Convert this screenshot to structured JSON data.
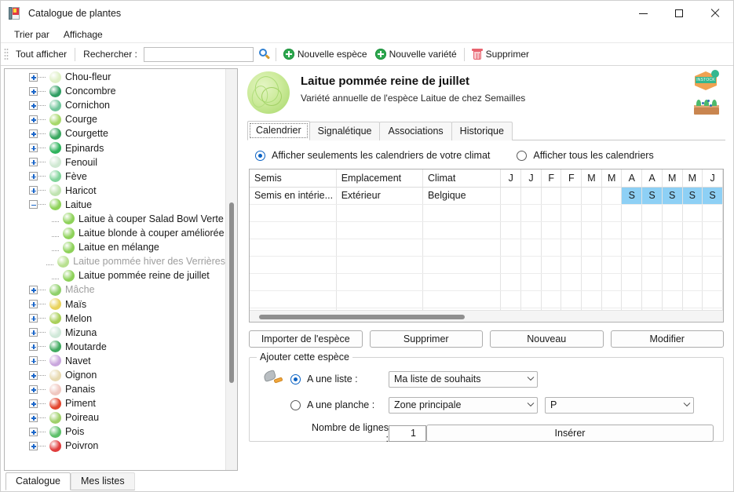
{
  "window": {
    "title": "Catalogue de plantes",
    "icon": "book-icon",
    "minimize": "minimize-icon",
    "maximize": "maximize-icon",
    "close": "close-icon"
  },
  "menubar": {
    "items": [
      "Trier par",
      "Affichage"
    ]
  },
  "toolbar": {
    "show_all": "Tout afficher",
    "search_label": "Rechercher :",
    "search_value": "",
    "search_placeholder": "",
    "search_icon": "search-icon",
    "new_species": "Nouvelle espèce",
    "new_variety": "Nouvelle variété",
    "delete": "Supprimer"
  },
  "tree": {
    "items": [
      {
        "label": "Chou-fleur",
        "level": 0,
        "expander": "plus",
        "dim": false,
        "color": "#dff0c6"
      },
      {
        "label": "Concombre",
        "level": 0,
        "expander": "plus",
        "dim": false,
        "color": "#2e9e62"
      },
      {
        "label": "Cornichon",
        "level": 0,
        "expander": "plus",
        "dim": false,
        "color": "#6fc59a"
      },
      {
        "label": "Courge",
        "level": 0,
        "expander": "plus",
        "dim": false,
        "color": "#a7d86a"
      },
      {
        "label": "Courgette",
        "level": 0,
        "expander": "plus",
        "dim": false,
        "color": "#3aa75f"
      },
      {
        "label": "Epinards",
        "level": 0,
        "expander": "plus",
        "dim": false,
        "color": "#2eb35c"
      },
      {
        "label": "Fenouil",
        "level": 0,
        "expander": "plus",
        "dim": false,
        "color": "#cfe8d2"
      },
      {
        "label": "Fève",
        "level": 0,
        "expander": "plus",
        "dim": false,
        "color": "#7fd39a"
      },
      {
        "label": "Haricot",
        "level": 0,
        "expander": "plus",
        "dim": false,
        "color": "#bfe3b0"
      },
      {
        "label": "Laitue",
        "level": 0,
        "expander": "minus",
        "dim": false,
        "color": "#8ed25a"
      },
      {
        "label": "Laitue à couper Salad Bowl Verte",
        "level": 1,
        "expander": "none",
        "dim": false,
        "color": "#8ed25a"
      },
      {
        "label": "Laitue blonde à couper améliorée",
        "level": 1,
        "expander": "none",
        "dim": false,
        "color": "#8ed25a"
      },
      {
        "label": "Laitue en mélange",
        "level": 1,
        "expander": "none",
        "dim": false,
        "color": "#8ed25a"
      },
      {
        "label": "Laitue pommée hiver des Verrières",
        "level": 1,
        "expander": "none",
        "dim": true,
        "color": "#b8e08f"
      },
      {
        "label": "Laitue pommée reine de juillet",
        "level": 1,
        "expander": "none",
        "dim": false,
        "color": "#8ed25a"
      },
      {
        "label": "Mâche",
        "level": 0,
        "expander": "plus",
        "dim": true,
        "color": "#8fd06a"
      },
      {
        "label": "Maïs",
        "level": 0,
        "expander": "plus",
        "dim": false,
        "color": "#e8d25c"
      },
      {
        "label": "Melon",
        "level": 0,
        "expander": "plus",
        "dim": false,
        "color": "#a9cf58"
      },
      {
        "label": "Mizuna",
        "level": 0,
        "expander": "plus",
        "dim": false,
        "color": "#cfe8d8"
      },
      {
        "label": "Moutarde",
        "level": 0,
        "expander": "plus",
        "dim": false,
        "color": "#3fa95f"
      },
      {
        "label": "Navet",
        "level": 0,
        "expander": "plus",
        "dim": false,
        "color": "#c9a6dd"
      },
      {
        "label": "Oignon",
        "level": 0,
        "expander": "plus",
        "dim": false,
        "color": "#e7d9b0"
      },
      {
        "label": "Panais",
        "level": 0,
        "expander": "plus",
        "dim": false,
        "color": "#f0c7c0"
      },
      {
        "label": "Piment",
        "level": 0,
        "expander": "plus",
        "dim": false,
        "color": "#e2462f"
      },
      {
        "label": "Poireau",
        "level": 0,
        "expander": "plus",
        "dim": false,
        "color": "#9fd06a"
      },
      {
        "label": "Pois",
        "level": 0,
        "expander": "plus",
        "dim": false,
        "color": "#5cc06a"
      },
      {
        "label": "Poivron",
        "level": 0,
        "expander": "plus",
        "dim": false,
        "color": "#e03c3c"
      }
    ],
    "tabs": [
      {
        "label": "Catalogue",
        "active": true
      },
      {
        "label": "Mes listes",
        "active": false
      }
    ]
  },
  "detail": {
    "avatar": "lettuce-icon",
    "title": "Laitue pommée reine de juillet",
    "subtitle": "Variété annuelle de l'espèce Laitue de chez Semailles",
    "badges": [
      {
        "name": "in-stock-badge",
        "label": "INSTOCK"
      },
      {
        "name": "sowing-badge",
        "label": ""
      }
    ],
    "tabs": [
      {
        "label": "Calendrier",
        "active": true
      },
      {
        "label": "Signalétique",
        "active": false
      },
      {
        "label": "Associations",
        "active": false
      },
      {
        "label": "Historique",
        "active": false
      }
    ],
    "filter": {
      "option_own": "Afficher seulements les calendriers de votre climat",
      "option_all": "Afficher tous les calendriers",
      "selected": "own"
    },
    "calendar": {
      "columns": [
        "Semis",
        "Emplacement",
        "Climat"
      ],
      "months": [
        "J",
        "J",
        "F",
        "F",
        "M",
        "M",
        "A",
        "A",
        "M",
        "M",
        "J"
      ],
      "rows": [
        {
          "semis": "Semis en intérie...",
          "emplacement": "Extérieur",
          "climat": "Belgique",
          "cells": [
            "",
            "",
            "",
            "",
            "",
            "",
            "S",
            "S",
            "S",
            "S",
            "S"
          ]
        }
      ],
      "empty_rows": 7,
      "selected_color": "#8ed0f5"
    },
    "buttons": [
      "Importer de l'espèce",
      "Supprimer",
      "Nouveau",
      "Modifier"
    ],
    "add_group": {
      "title": "Ajouter cette espèce",
      "tool_icon": "trowel-icon",
      "option_list_label": "A une liste :",
      "option_list_value": "Ma liste de souhaits",
      "option_bed_label": "A une planche :",
      "option_bed_value": "Zone principale",
      "option_bed_sub_value": "P",
      "selected": "list",
      "rows_label": "Nombre de lignes :",
      "rows_value": "1",
      "insert_button": "Insérer"
    }
  }
}
